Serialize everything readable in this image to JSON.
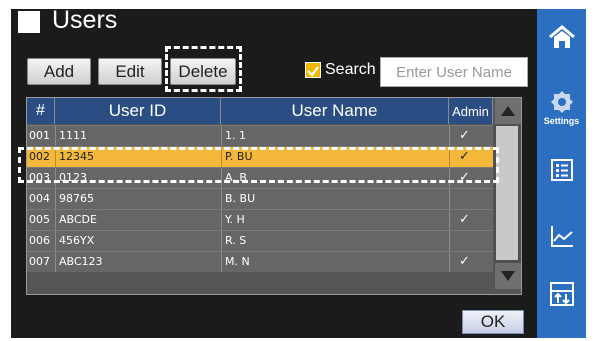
{
  "header": {
    "title": "Users"
  },
  "toolbar": {
    "add_label": "Add",
    "edit_label": "Edit",
    "delete_label": "Delete",
    "search_label": "Search",
    "search_checked": true,
    "search_placeholder": "Enter User Name"
  },
  "table": {
    "columns": [
      "#",
      "User ID",
      "User Name",
      "Admin"
    ],
    "rows": [
      {
        "num": "001",
        "user_id": "1111",
        "user_name": "1. 1",
        "admin": true,
        "selected": false
      },
      {
        "num": "002",
        "user_id": "12345",
        "user_name": "P. BU",
        "admin": true,
        "selected": true
      },
      {
        "num": "003",
        "user_id": "0123",
        "user_name": "A. B",
        "admin": true,
        "selected": false
      },
      {
        "num": "004",
        "user_id": "98765",
        "user_name": "B. BU",
        "admin": false,
        "selected": false
      },
      {
        "num": "005",
        "user_id": "ABCDE",
        "user_name": "Y. H",
        "admin": true,
        "selected": false
      },
      {
        "num": "006",
        "user_id": "456YX",
        "user_name": "R. S",
        "admin": false,
        "selected": false
      },
      {
        "num": "007",
        "user_id": "ABC123",
        "user_name": "M. N",
        "admin": true,
        "selected": false
      }
    ],
    "admin_mark": "✓"
  },
  "footer": {
    "ok_label": "OK"
  },
  "sidebar": {
    "items": [
      {
        "name": "home",
        "icon": "home-icon",
        "label": ""
      },
      {
        "name": "settings",
        "icon": "gear-icon",
        "label": "Settings"
      },
      {
        "name": "list",
        "icon": "checklist-icon",
        "label": ""
      },
      {
        "name": "chart",
        "icon": "line-chart-icon",
        "label": ""
      },
      {
        "name": "transfer",
        "icon": "transfer-icon",
        "label": ""
      }
    ]
  },
  "colors": {
    "accent": "#2c6fc0",
    "header_row": "#2a4e83",
    "selected_row": "#f3b73c",
    "checkbox": "#f2b600"
  }
}
